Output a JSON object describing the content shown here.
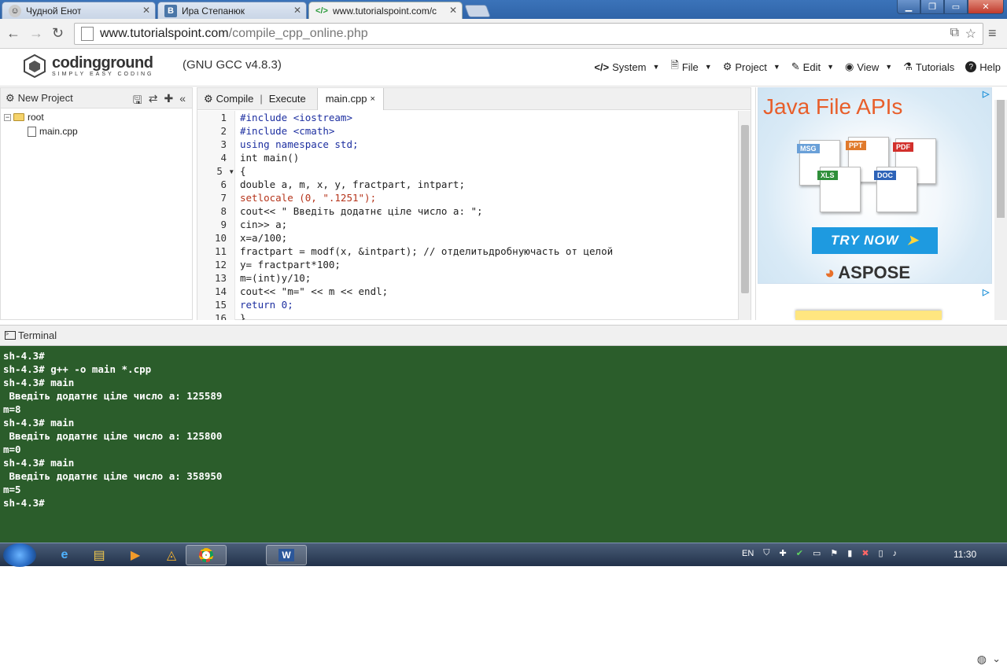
{
  "browser": {
    "tabs": [
      {
        "title": "Чудной Енот",
        "icon": "raccoon-icon"
      },
      {
        "title": "Ира Степанюк",
        "icon": "vk-icon"
      },
      {
        "title": "www.tutorialspoint.com/c",
        "icon": "code-icon"
      }
    ],
    "address": {
      "host": "www.tutorialspoint.com",
      "path": "/compile_cpp_online.php"
    }
  },
  "header": {
    "logo_name": "codingground",
    "logo_tagline": "SIMPLY EASY CODING",
    "compiler": "(GNU GCC v4.8.3)",
    "menu": {
      "system": "System",
      "file": "File",
      "project": "Project",
      "edit": "Edit",
      "view": "View",
      "tutorials": "Tutorials",
      "help": "Help"
    }
  },
  "sidebar": {
    "title": "New Project",
    "tree": {
      "root": "root",
      "file": "main.cpp"
    }
  },
  "editor": {
    "compile": "Compile",
    "separator": "|",
    "execute": "Execute",
    "file_tab": "main.cpp",
    "line_numbers": [
      "1",
      "2",
      "3",
      "4",
      "5",
      "6",
      "7",
      "8",
      "9",
      "10",
      "11",
      "12",
      "13",
      "14",
      "15",
      "16"
    ],
    "lines": [
      "#include <iostream>",
      "#include <cmath>",
      "using namespace std;",
      "int main()",
      "{",
      "double a, m, x, y, fractpart, intpart;",
      "setlocale (0, \".1251\");",
      "cout<< \" Введіть додатнє ціле число а: \";",
      "cin>> a;",
      "x=a/100;",
      "fractpart = modf(x, &intpart); // отделитьдробнуючасть от целой",
      "y= fractpart*100;",
      "m=(int)y/10;",
      "cout<< \"m=\" << m << endl;",
      "return 0;",
      "}"
    ]
  },
  "ad": {
    "title": "Java File APIs",
    "button": "TRY NOW",
    "brand": "ASPOSE",
    "doc_labels": [
      "MSG",
      "PPT",
      "PDF",
      "XLS",
      "DOC"
    ]
  },
  "terminal": {
    "title": "Terminal",
    "lines": [
      "sh-4.3#",
      "sh-4.3# g++ -o main *.cpp",
      "sh-4.3# main",
      " Введіть додатнє ціле число а: 125589",
      "m=8",
      "sh-4.3# main",
      " Введіть додатнє ціле число а: 125800",
      "m=0",
      "sh-4.3# main",
      " Введіть додатнє ціле число а: 358950",
      "m=5",
      "sh-4.3#"
    ]
  },
  "taskbar": {
    "language": "EN",
    "time": "11:30"
  }
}
